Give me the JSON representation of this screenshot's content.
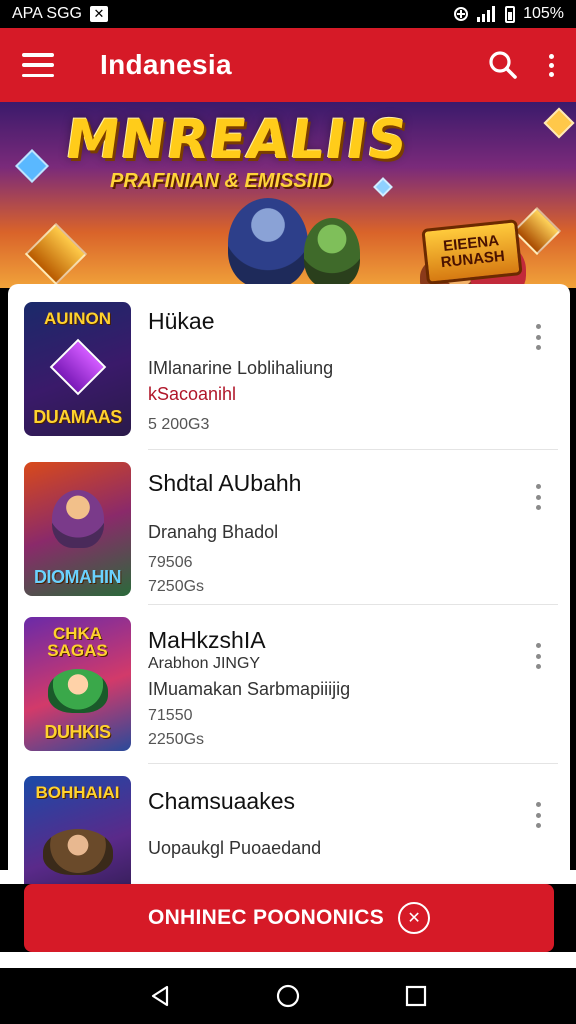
{
  "status_bar": {
    "left_text": "APA SGG",
    "notification_icon": "x-box-icon",
    "right_icons": [
      "data-saver-icon",
      "signal-icon",
      "battery-icon"
    ],
    "battery_text": "105%"
  },
  "app_bar": {
    "title": "Indanesia",
    "menu_icon": "hamburger-icon",
    "search_icon": "search-icon",
    "more_icon": "more-vert-icon"
  },
  "banner": {
    "title": "MNREALIIS",
    "subtitle": "PRAFINIAN & EMISSIID",
    "badge_line1": "EIEENA",
    "badge_line2": "RUNASH"
  },
  "list": {
    "items": [
      {
        "thumb_top": "AUINON",
        "thumb_bottom": "DUAMAAS",
        "title": "Hükae",
        "line1": "IMlanarine Loblihaliung",
        "line2": "kSacoanihl",
        "meta1": "5 200G3",
        "meta2": ""
      },
      {
        "thumb_top": "",
        "thumb_bottom": "DIOMAHIN",
        "title": "Shdtal AUbahh",
        "line1": "Dranahg Bhadol",
        "line2": "",
        "meta1": "79506",
        "meta2": "7250Gs"
      },
      {
        "thumb_top": "CHKA SAGAS",
        "thumb_bottom": "DUHKIS",
        "title": "MaHkzshIA",
        "line1": "Arabhon JINGY",
        "line2": "IMuamakan Sarbmapiiijig",
        "meta1": "71550",
        "meta2": "2250Gs"
      },
      {
        "thumb_top": "BOHHAIAI",
        "thumb_bottom": "",
        "title": "Chamsuaakes",
        "line1": "Uopaukgl Puoaedand",
        "line2": "",
        "meta1": "",
        "meta2": ""
      }
    ]
  },
  "cta": {
    "label": "ONHINEC POONONICS",
    "icon_text": "⊗"
  },
  "nav_bar": {
    "back_icon": "back-triangle-icon",
    "home_icon": "home-circle-icon",
    "recents_icon": "recents-square-icon"
  },
  "colors": {
    "brand_red": "#d61a27",
    "accent_text_red": "#b0172a",
    "banner_gold": "#ffcc1a"
  }
}
